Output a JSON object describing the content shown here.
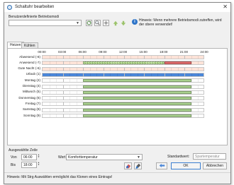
{
  "window": {
    "title": "Schaltuhr bearbeiten",
    "close_glyph": "✕"
  },
  "top": {
    "user_modes_label": "Benutzerdefinierte Betriebsmodi",
    "user_modes_value": "",
    "hint": "Hinweis: Wenn mehrere Betriebsmodi zutreffen, wird der obere verwendet!"
  },
  "tabs": [
    {
      "label": "Heizen"
    },
    {
      "label": "Kühlen"
    }
  ],
  "schedule": {
    "hours": [
      "00:00",
      "03:00",
      "06:00",
      "09:00",
      "12:00",
      "15:00",
      "18:00",
      "21:00",
      "24:00"
    ],
    "rows": [
      {
        "label": "Abwesend (-8)",
        "bg": "#fde3d8",
        "segments": []
      },
      {
        "label": "Anwesend (-7)",
        "bg": "#fde3d8",
        "segments": [
          {
            "from": 6,
            "to": 18,
            "kind": "hatch"
          },
          {
            "from": 18,
            "to": 22,
            "kind": "red"
          }
        ]
      },
      {
        "label": "Gute Nacht (-6)",
        "bg": "#fde3d8",
        "segments": []
      },
      {
        "label": "Urlaub (1)",
        "bg": "#4a86d8",
        "segments": []
      },
      {
        "label": "Montag (2)",
        "bg": "#ffffff",
        "segments": [
          {
            "from": 6,
            "to": 22,
            "kind": "green"
          }
        ]
      },
      {
        "label": "Dienstag (4)",
        "bg": "#ffffff",
        "segments": [
          {
            "from": 6,
            "to": 22,
            "kind": "green"
          }
        ]
      },
      {
        "label": "Mittwoch (5)",
        "bg": "#ffffff",
        "segments": [
          {
            "from": 6,
            "to": 22,
            "kind": "green"
          }
        ]
      },
      {
        "label": "Donnerstag (6)",
        "bg": "#ffffff",
        "segments": [
          {
            "from": 6,
            "to": 22,
            "kind": "green"
          }
        ]
      },
      {
        "label": "Freitag (7)",
        "bg": "#ffffff",
        "segments": [
          {
            "from": 6,
            "to": 22,
            "kind": "green"
          }
        ]
      },
      {
        "label": "Samstag (8)",
        "bg": "#ffffff",
        "segments": [
          {
            "from": 6,
            "to": 22,
            "kind": "green"
          }
        ]
      },
      {
        "label": "Sonntag (9)",
        "bg": "#ffffff",
        "segments": [
          {
            "from": 6,
            "to": 22,
            "kind": "green"
          }
        ]
      }
    ],
    "colors": {
      "green": "#a9d18e",
      "red": "#e06c6c",
      "hatch": "#cfe8b4"
    }
  },
  "selected_row": {
    "section_label": "Ausgewählte Zeile",
    "from_label": "Von",
    "from_value": "06:00",
    "to_label": "Bis",
    "to_value": "18:00",
    "value_label": "Wert",
    "value_selected": "Komforttemperatur"
  },
  "standard": {
    "label": "Standardwert:",
    "value": "Spartemperatur"
  },
  "buttons": {
    "ok": "OK",
    "cancel": "Abbrechen"
  },
  "footer_hint": "Hinweis: Mit Strg Auswählen ermöglicht das Klonen eines Eintrags!"
}
